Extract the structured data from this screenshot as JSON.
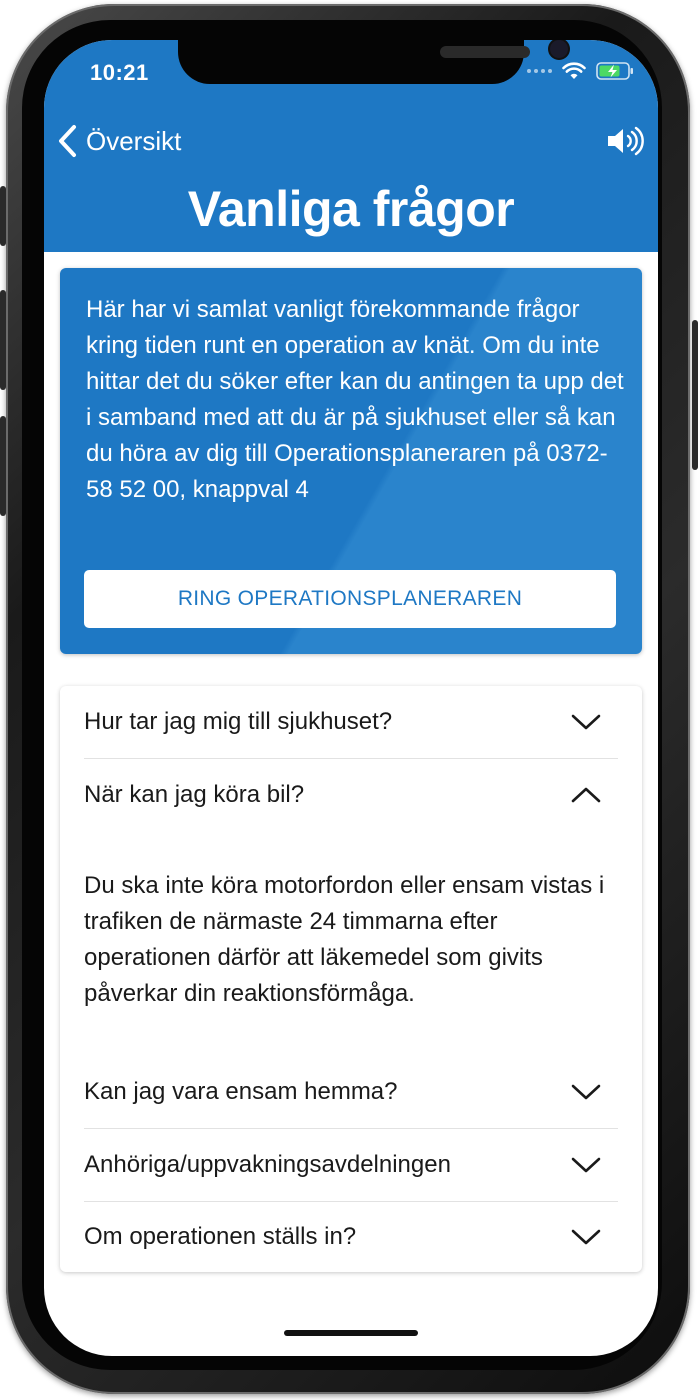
{
  "status_bar": {
    "time": "10:21",
    "icons": [
      "cellular-dots-icon",
      "wifi-icon",
      "battery-charging-icon"
    ]
  },
  "nav": {
    "back_label": "Översikt",
    "back_icon": "chevron-left-icon",
    "sound_icon": "speaker-volume-icon"
  },
  "page": {
    "title": "Vanliga frågor"
  },
  "intro": {
    "text": "Här har vi samlat vanligt förekommande frågor kring tiden runt en operation av knät. Om du inte hittar det du söker efter kan du antingen ta upp det i samband med att du är på sjukhuset eller så kan du höra av dig till Operationsplaneraren på 0372-58 52 00, knappval 4",
    "button_label": "RING OPERATIONSPLANERAREN"
  },
  "faq": {
    "items": [
      {
        "question": "Hur tar jag mig till sjukhuset?",
        "expanded": false
      },
      {
        "question": "När kan jag köra bil?",
        "expanded": true,
        "answer": "Du ska inte köra motorfordon eller ensam vistas i trafiken de närmaste 24 timmarna efter operationen därför att läkemedel som givits påverkar din reaktionsförmåga."
      },
      {
        "question": "Kan jag vara ensam hemma?",
        "expanded": false
      },
      {
        "question": "Anhöriga/uppvakningsavdelningen",
        "expanded": false
      },
      {
        "question": "Om operationen ställs in?",
        "expanded": false
      }
    ]
  },
  "colors": {
    "brand_blue": "#1e78c4",
    "background": "#ffffff",
    "text": "#1a1a1a"
  }
}
